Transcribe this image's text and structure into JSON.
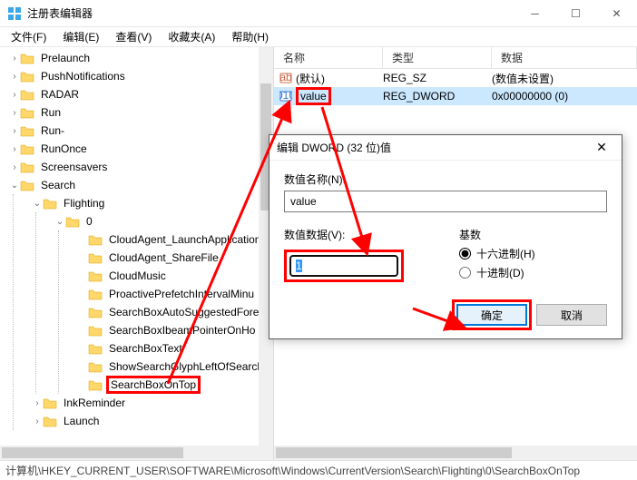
{
  "window": {
    "title": "注册表编辑器"
  },
  "menu": {
    "file": "文件(F)",
    "edit": "编辑(E)",
    "view": "查看(V)",
    "favorites": "收藏夹(A)",
    "help": "帮助(H)"
  },
  "tree": {
    "items": [
      {
        "label": "Prelaunch",
        "exp": false
      },
      {
        "label": "PushNotifications",
        "exp": false
      },
      {
        "label": "RADAR",
        "exp": false
      },
      {
        "label": "Run",
        "exp": false
      },
      {
        "label": "Run-",
        "exp": false
      },
      {
        "label": "RunOnce",
        "exp": false
      },
      {
        "label": "Screensavers",
        "exp": false
      },
      {
        "label": "Search",
        "exp": true,
        "children": [
          {
            "label": "Flighting",
            "exp": true,
            "children": [
              {
                "label": "0",
                "exp": true,
                "children": [
                  {
                    "label": "CloudAgent_LaunchApplication"
                  },
                  {
                    "label": "CloudAgent_ShareFile"
                  },
                  {
                    "label": "CloudMusic"
                  },
                  {
                    "label": "ProactivePrefetchIntervalMinu"
                  },
                  {
                    "label": "SearchBoxAutoSuggestedFore"
                  },
                  {
                    "label": "SearchBoxIbeamPointerOnHo"
                  },
                  {
                    "label": "SearchBoxText"
                  },
                  {
                    "label": "ShowSearchGlyphLeftOfSearch"
                  },
                  {
                    "label": "SearchBoxOnTop",
                    "hl": true
                  }
                ]
              }
            ]
          },
          {
            "label": "InkReminder",
            "exp": false
          },
          {
            "label": "Launch",
            "exp": false
          }
        ]
      }
    ]
  },
  "list": {
    "cols": {
      "name": "名称",
      "type": "类型",
      "data": "数据"
    },
    "rows": [
      {
        "name": "(默认)",
        "type": "REG_SZ",
        "data": "(数值未设置)",
        "icon": "str"
      },
      {
        "name": "value",
        "type": "REG_DWORD",
        "data": "0x00000000 (0)",
        "icon": "bin",
        "sel": true,
        "hl": true
      }
    ]
  },
  "dialog": {
    "title": "编辑 DWORD (32 位)值",
    "name_label": "数值名称(N):",
    "name_value": "value",
    "data_label": "数值数据(V):",
    "data_value": "1",
    "base_label": "基数",
    "radix_hex": "十六进制(H)",
    "radix_dec": "十进制(D)",
    "ok": "确定",
    "cancel": "取消"
  },
  "statusbar": {
    "path": "计算机\\HKEY_CURRENT_USER\\SOFTWARE\\Microsoft\\Windows\\CurrentVersion\\Search\\Flighting\\0\\SearchBoxOnTop"
  }
}
